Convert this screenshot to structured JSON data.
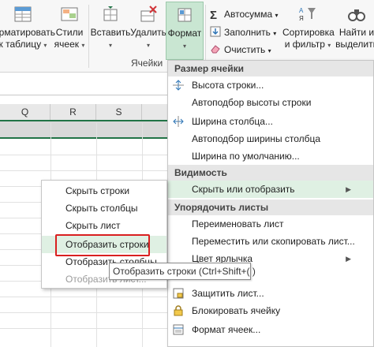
{
  "ribbon": {
    "format_table": "орматировать",
    "format_table2": "к таблицу",
    "styles": "Стили",
    "styles2": "ячеек",
    "insert": "Вставить",
    "delete": "Удалить",
    "format": "Формат",
    "cells_group": "Ячейки",
    "autosum": "Автосумма",
    "fill": "Заполнить",
    "clear": "Очистить",
    "sort": "Сортировка",
    "sort2": "и фильтр",
    "find": "Найти и",
    "find2": "выделить"
  },
  "columns": [
    "Q",
    "R",
    "S"
  ],
  "dropdown": {
    "section_size": "Размер ячейки",
    "row_height": "Высота строки...",
    "autofit_row": "Автоподбор высоты строки",
    "col_width": "Ширина столбца...",
    "autofit_col": "Автоподбор ширины столбца",
    "default_width": "Ширина по умолчанию...",
    "section_visibility": "Видимость",
    "hide_show": "Скрыть или отобразить",
    "section_order": "Упорядочить листы",
    "rename_sheet": "Переименовать лист",
    "move_copy": "Переместить или скопировать лист...",
    "tab_color": "Цвет ярлычка",
    "protect_sheet": "Защитить лист...",
    "lock_cell": "Блокировать ячейку",
    "format_cells": "Формат ячеек..."
  },
  "submenu": {
    "hide_rows": "Скрыть строки",
    "hide_cols": "Скрыть столбцы",
    "hide_sheet": "Скрыть лист",
    "show_rows": "Отобразить строки",
    "show_cols": "Отобразить столбцы",
    "show_sheet": "Отобразить лист..."
  },
  "tooltip": "Отобразить строки (Ctrl+Shift+( )",
  "colors": {
    "accent": "#217346",
    "highlight": "#dff0e3",
    "redbox": "#d92020"
  }
}
